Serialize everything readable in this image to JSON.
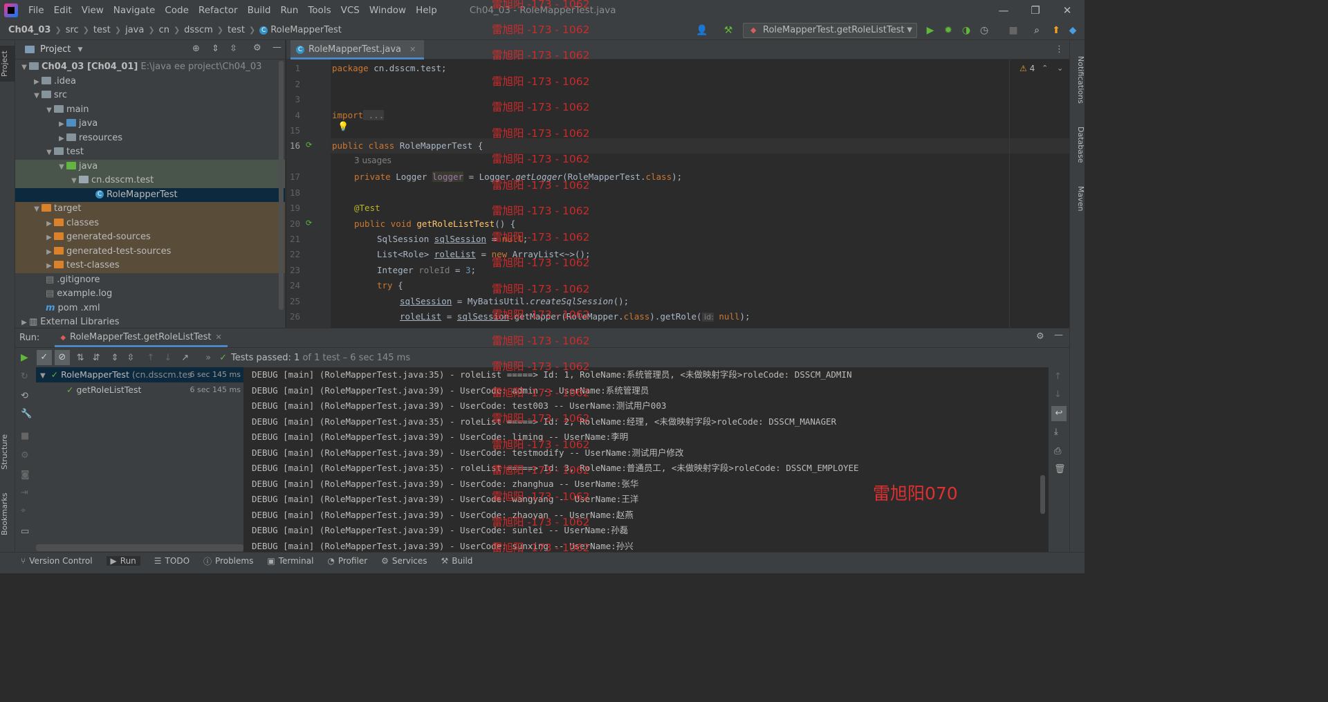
{
  "menubar": {
    "items": [
      "File",
      "Edit",
      "View",
      "Navigate",
      "Code",
      "Refactor",
      "Build",
      "Run",
      "Tools",
      "VCS",
      "Window",
      "Help"
    ],
    "title": "Ch04_03 - RoleMapperTest.java",
    "controls": [
      "—",
      "❐",
      "✕"
    ]
  },
  "navbar": {
    "crumbs": [
      "Ch04_03",
      "src",
      "test",
      "java",
      "cn",
      "dsscm",
      "test",
      "RoleMapperTest"
    ],
    "run_config": "RoleMapperTest.getRoleListTest"
  },
  "project": {
    "title": "Project",
    "tree": [
      {
        "label": "Ch04_03 [Ch04_01]",
        "extra": "E:\\java ee project\\Ch04_03"
      },
      {
        "label": ".idea"
      },
      {
        "label": "src"
      },
      {
        "label": "main"
      },
      {
        "label": "java"
      },
      {
        "label": "resources"
      },
      {
        "label": "test"
      },
      {
        "label": "java"
      },
      {
        "label": "cn.dsscm.test"
      },
      {
        "label": "RoleMapperTest"
      },
      {
        "label": "target"
      },
      {
        "label": "classes"
      },
      {
        "label": "generated-sources"
      },
      {
        "label": "generated-test-sources"
      },
      {
        "label": "test-classes"
      },
      {
        "label": ".gitignore"
      },
      {
        "label": "example.log"
      },
      {
        "label": "pom .xml"
      },
      {
        "label": "External Libraries"
      }
    ]
  },
  "editor": {
    "tab": "RoleMapperTest.java",
    "warnings": "4",
    "line_numbers": [
      "1",
      "2",
      "3",
      "4",
      "15",
      "16",
      "17",
      "18",
      "19",
      "20",
      "21",
      "22",
      "23",
      "24",
      "25",
      "26"
    ],
    "usages": "3 usages",
    "lines": {
      "l1_kw": "package",
      "l1_rest": " cn.dsscm.test;",
      "l4_kw": "import",
      "l4_rest": " ...",
      "l16_kw": "public class",
      "l16_name": " RoleMapperTest",
      "l16_rest": " {",
      "l17_kw": "private",
      "l17_a": " Logger ",
      "l17_field": "logger",
      "l17_b": " = Logger.",
      "l17_m": "getLogger",
      "l17_c": "(RoleMapperTest.",
      "l17_kw2": "class",
      "l17_d": ");",
      "l19": "@Test",
      "l20_kw": "public void",
      "l20_fn": " getRoleListTest",
      "l20_rest": "() {",
      "l21_a": "SqlSession ",
      "l21_var": "sqlSession",
      "l21_b": " = ",
      "l21_kw": "null",
      "l21_c": ";",
      "l22_a": "List<Role> ",
      "l22_var": "roleList",
      "l22_b": " = ",
      "l22_kw": "new",
      "l22_c": " ArrayList<~>();",
      "l23_a": "Integer ",
      "l23_var": "roleId",
      "l23_b": " = ",
      "l23_num": "3",
      "l23_c": ";",
      "l24_kw": "try",
      "l24_rest": " {",
      "l25_var": "sqlSession",
      "l25_a": " = MyBatisUtil.",
      "l25_m": "createSqlSession",
      "l25_b": "();",
      "l26_var": "roleList",
      "l26_a": " = ",
      "l26_var2": "sqlSession",
      "l26_b": ".getMapper(RoleMapper.",
      "l26_kw": "class",
      "l26_c": ").getRole(",
      "l26_hint": " id:",
      "l26_kw2": " null",
      "l26_d": ");"
    }
  },
  "run": {
    "label": "Run:",
    "tab": "RoleMapperTest.getRoleListTest",
    "status_prefix": "Tests passed:",
    "status_count": "1",
    "status_rest": "of 1 test – 6 sec 145 ms",
    "tree": [
      {
        "label": "RoleMapperTest",
        "pkg": "(cn.dsscm.tes",
        "time": "6 sec 145 ms"
      },
      {
        "label": "getRoleListTest",
        "time": "6 sec 145 ms"
      }
    ],
    "console": [
      "DEBUG [main] (RoleMapperTest.java:35) - roleList =====> Id: 1, RoleName:系统管理员, <未做映射字段>roleCode: DSSCM_ADMIN",
      "DEBUG [main] (RoleMapperTest.java:39) - UserCode: admin -- UserName:系统管理员",
      "DEBUG [main] (RoleMapperTest.java:39) - UserCode: test003 -- UserName:测试用户003",
      "DEBUG [main] (RoleMapperTest.java:35) - roleList =====> Id: 2, RoleName:经理, <未做映射字段>roleCode: DSSCM_MANAGER",
      "DEBUG [main] (RoleMapperTest.java:39) - UserCode: liming -- UserName:李明",
      "DEBUG [main] (RoleMapperTest.java:39) - UserCode: testmodify -- UserName:测试用户修改",
      "DEBUG [main] (RoleMapperTest.java:35) - roleList =====> Id: 3, RoleName:普通员工, <未做映射字段>roleCode: DSSCM_EMPLOYEE",
      "DEBUG [main] (RoleMapperTest.java:39) - UserCode: zhanghua -- UserName:张华",
      "DEBUG [main] (RoleMapperTest.java:39) - UserCode: wangyang -- UserName:王洋",
      "DEBUG [main] (RoleMapperTest.java:39) - UserCode: zhaoyan -- UserName:赵燕",
      "DEBUG [main] (RoleMapperTest.java:39) - UserCode: sunlei -- UserName:孙磊",
      "DEBUG [main] (RoleMapperTest.java:39) - UserCode: sunxing -- UserName:孙兴"
    ]
  },
  "left_stripe": {
    "project": "Project",
    "structure": "Structure",
    "bookmarks": "Bookmarks"
  },
  "right_stripe": {
    "notifications": "Notifications",
    "database": "Database",
    "maven": "Maven"
  },
  "bottom_tabs": [
    "Version Control",
    "Run",
    "TODO",
    "Problems",
    "Terminal",
    "Profiler",
    "Services",
    "Build"
  ],
  "watermark": {
    "repeat": "雷旭阳 -173 - 1062",
    "big": "雷旭阳070"
  },
  "colors": {
    "accent": "#4a88c7",
    "pass": "#5fb83a",
    "watermark": "#d42a2a",
    "keyword": "#cc7832",
    "method": "#ffc66d"
  }
}
